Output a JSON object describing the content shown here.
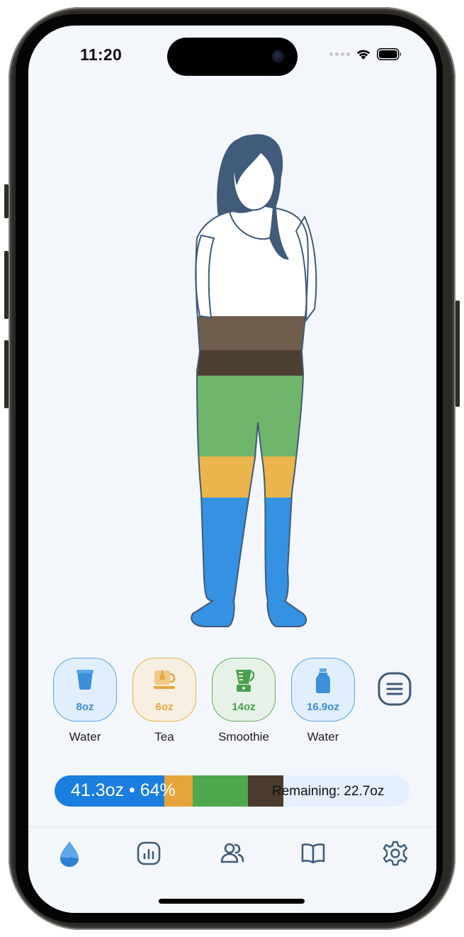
{
  "status_bar": {
    "time": "11:20"
  },
  "drinks": [
    {
      "amount": "8oz",
      "label": "Water",
      "icon": "cup-icon",
      "color": "#3d8fd8",
      "bg": "#e1eefc",
      "border": "#5aa6e6"
    },
    {
      "amount": "6oz",
      "label": "Tea",
      "icon": "tea-icon",
      "color": "#e6a73c",
      "bg": "#f7efe1",
      "border": "#e8b04a"
    },
    {
      "amount": "14oz",
      "label": "Smoothie",
      "icon": "blender-icon",
      "color": "#4a9f4e",
      "bg": "#e6f2e7",
      "border": "#62ad63"
    },
    {
      "amount": "16.9oz",
      "label": "Water",
      "icon": "bottle-icon",
      "color": "#3d8fd8",
      "bg": "#e1eefc",
      "border": "#5aa6e6"
    }
  ],
  "progress": {
    "total_label": "41.3oz • 64%",
    "remaining_label": "Remaining: 22.7oz",
    "percent": 64,
    "segments": [
      {
        "name": "water",
        "color": "#1a7ede",
        "fraction": 0.31
      },
      {
        "name": "tea",
        "color": "#e6a53a",
        "fraction": 0.08
      },
      {
        "name": "smoothie",
        "color": "#4fa84d",
        "fraction": 0.155
      },
      {
        "name": "coffee",
        "color": "#4a3b2c",
        "fraction": 0.1
      }
    ]
  },
  "fill_layers": [
    {
      "drink": "water",
      "color": "#3592e2"
    },
    {
      "drink": "tea",
      "color": "#ecb44c"
    },
    {
      "drink": "smoothie",
      "color": "#6fb56b"
    },
    {
      "drink": "coffee",
      "color": "#4e3f33"
    },
    {
      "drink": "coffee-light",
      "color": "#6f5e4d"
    }
  ],
  "tabs": [
    {
      "name": "tab-hydration",
      "icon": "water-drop-icon",
      "active": true
    },
    {
      "name": "tab-stats",
      "icon": "chart-icon",
      "active": false
    },
    {
      "name": "tab-friends",
      "icon": "people-icon",
      "active": false
    },
    {
      "name": "tab-learn",
      "icon": "book-icon",
      "active": false
    },
    {
      "name": "tab-settings",
      "icon": "gear-icon",
      "active": false
    }
  ],
  "colors": {
    "accent": "#3d8fd8",
    "icon_default": "#3f5a78",
    "background": "#f3f7fc"
  }
}
